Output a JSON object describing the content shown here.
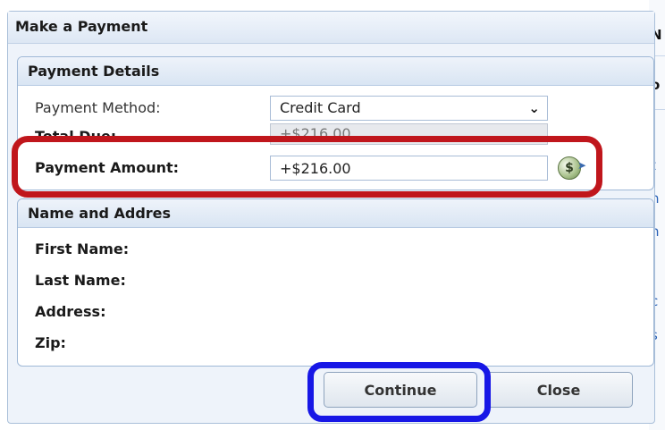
{
  "dialog": {
    "title": "Make a Payment"
  },
  "payment_details": {
    "header": "Payment Details",
    "method_label": "Payment Method:",
    "method_value": "Credit Card",
    "total_due_label": "Total Due:",
    "total_due_value": "+$216.00",
    "amount_label": "Payment Amount:",
    "amount_value": "+$216.00",
    "amount_icon": "coin-dollar-icon"
  },
  "name_address": {
    "header": "Name and Addres",
    "first_name_label": "First Name:",
    "last_name_label": "Last Name:",
    "address_label": "Address:",
    "zip_label": "Zip:"
  },
  "buttons": {
    "continue": "Continue",
    "close": "Close"
  },
  "background": {
    "fragments": [
      "N",
      "o",
      "t",
      "h",
      "n",
      "i",
      "p",
      "c",
      "s"
    ]
  },
  "colors": {
    "annotation_red": "#c0161c",
    "annotation_blue": "#1717e6",
    "panel_border": "#9fb8d6"
  }
}
